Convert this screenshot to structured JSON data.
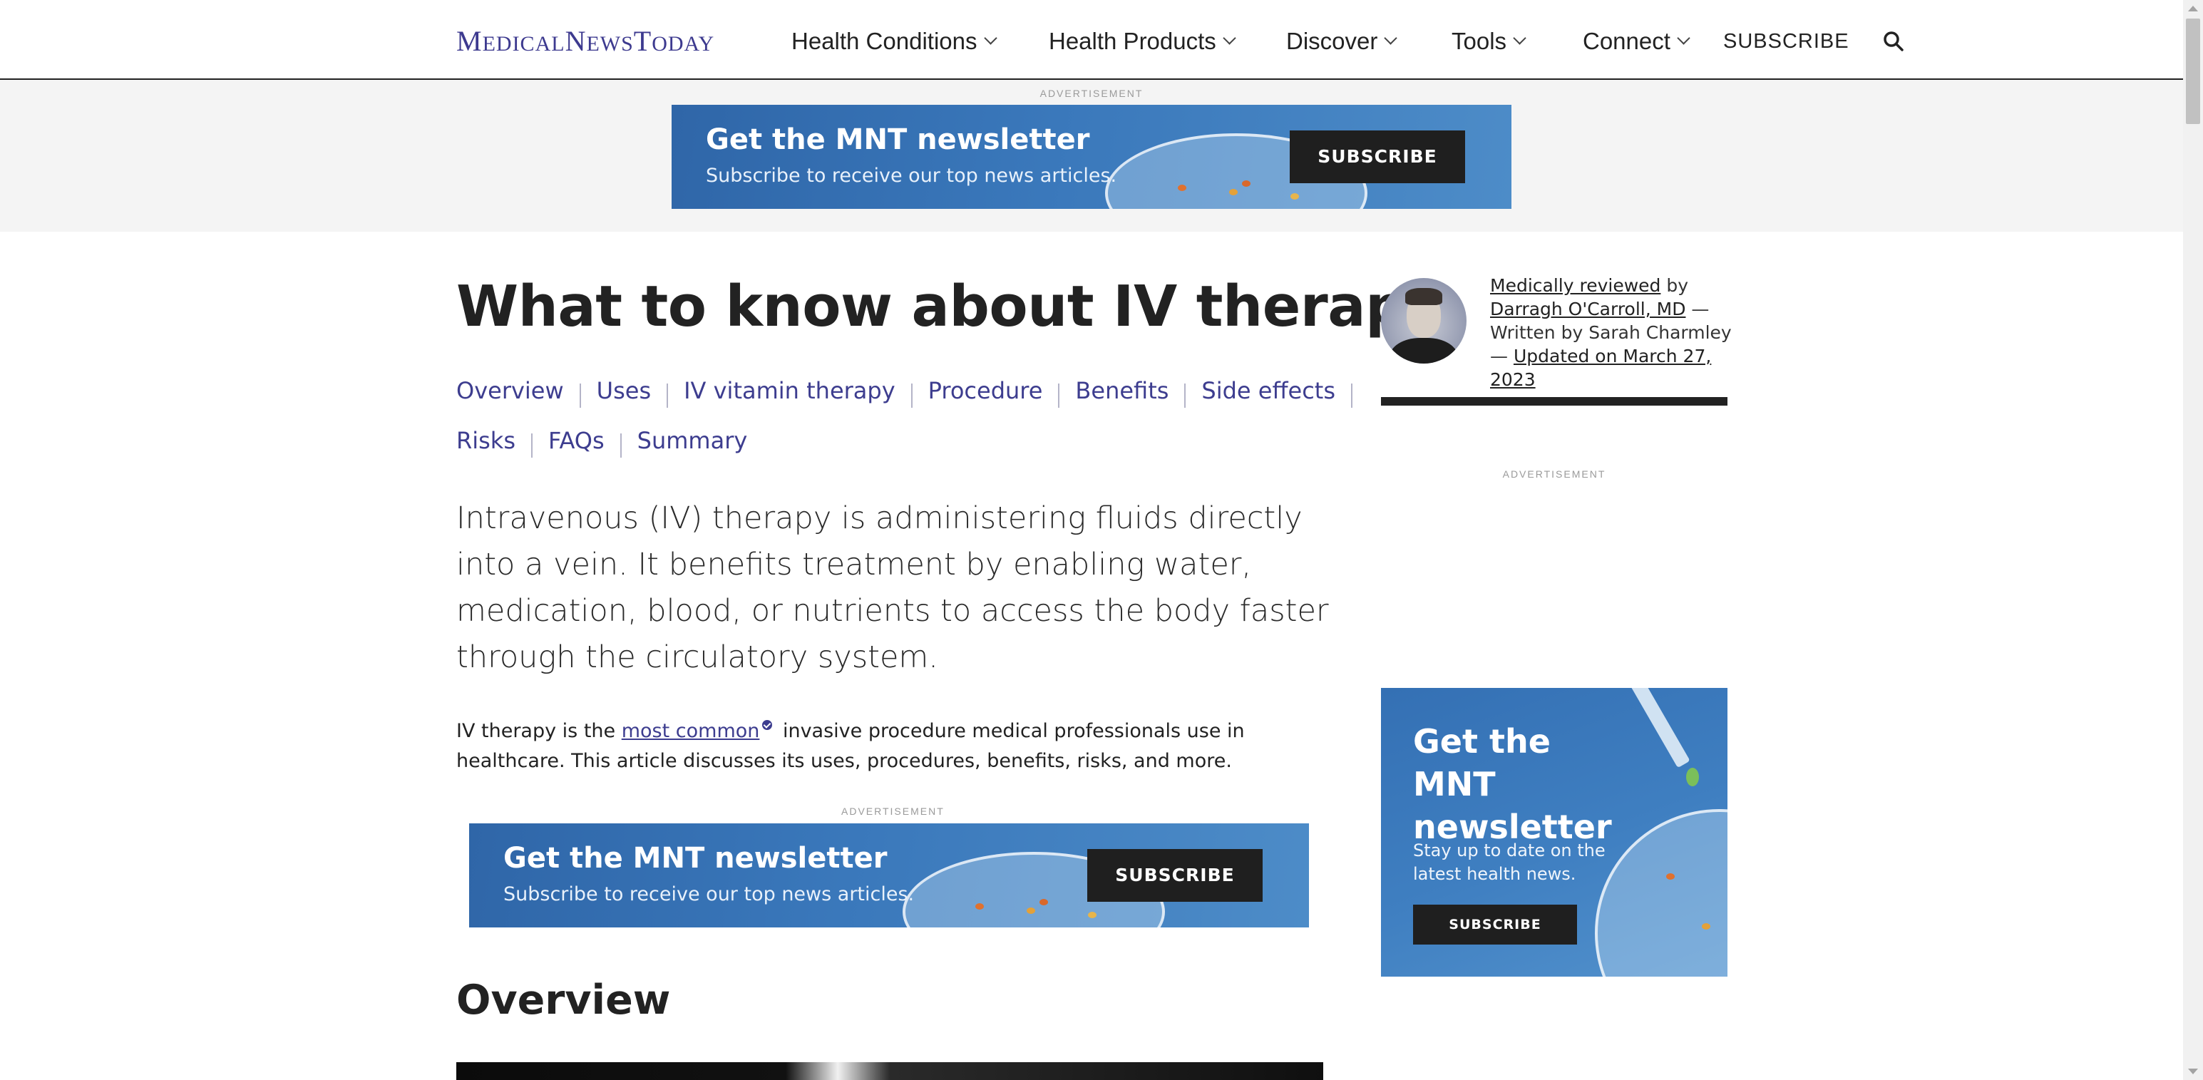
{
  "site": {
    "logo_text": "MedicalNewsToday"
  },
  "nav": {
    "items": [
      "Health Conditions",
      "Health Products",
      "Discover",
      "Tools",
      "Connect"
    ],
    "subscribe_label": "SUBSCRIBE",
    "search_icon": "search-icon"
  },
  "top_ad": {
    "label": "ADVERTISEMENT",
    "title": "Get the MNT newsletter",
    "subtitle": "Subscribe to receive our top news articles.",
    "button": "SUBSCRIBE"
  },
  "article": {
    "title": "What to know about IV therapy",
    "toc_row1": [
      "Overview",
      "Uses",
      "IV vitamin therapy",
      "Procedure",
      "Benefits",
      "Side effects"
    ],
    "toc_row2": [
      "Risks",
      "FAQs",
      "Summary"
    ],
    "lede": "Intravenous (IV) therapy is administering fluids directly into a vein. It benefits treatment by enabling water, medication, blood, or nutrients to access the body faster through the circulatory system.",
    "para_before_link": "IV therapy is the ",
    "para_link": "most common",
    "para_after_link": " invasive procedure medical professionals use in healthcare. This article discusses its uses, procedures, benefits, risks, and more.",
    "overview_heading": "Overview"
  },
  "inline_ad": {
    "label": "ADVERTISEMENT",
    "title": "Get the MNT newsletter",
    "subtitle": "Subscribe to receive our top news articles.",
    "button": "SUBSCRIBE"
  },
  "byline": {
    "reviewed_link": "Medically reviewed",
    "by": " by ",
    "reviewer": "Darragh O'Carroll, MD",
    "dash1": " — Written by Sarah Charmley — ",
    "updated": "Updated on March 27, 2023"
  },
  "sidebar_ad": {
    "label": "ADVERTISEMENT",
    "title": "Get the MNT newsletter",
    "subtitle": "Stay up to date on the latest health news.",
    "button": "SUBSCRIBE"
  },
  "colors": {
    "brand": "#3d3a8f",
    "link": "#3d3d8f",
    "newsletter_blue": "#3a78bb",
    "button_dark": "#1f1f1f"
  }
}
